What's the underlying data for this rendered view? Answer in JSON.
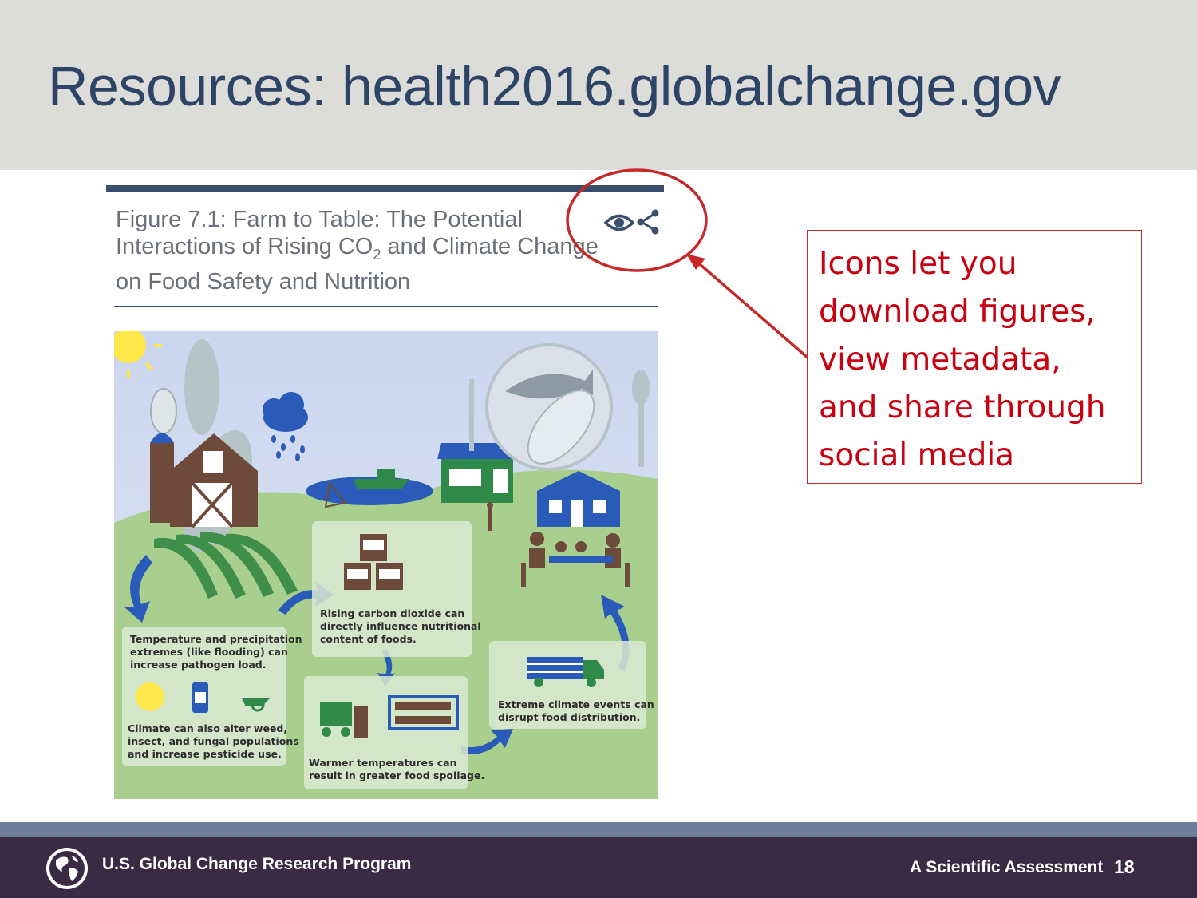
{
  "slide": {
    "title": "Resources: health2016.globalchange.gov",
    "page_number": "18"
  },
  "figure": {
    "caption_line1": "Figure 7.1: Farm to Table: The Potential",
    "caption_line2_pre": "Interactions of Rising CO",
    "caption_line2_sub": "2",
    "caption_line2_post": " and Climate Change",
    "caption_line3": "on Food Safety and Nutrition",
    "icons": [
      "eye-icon",
      "share-icon"
    ],
    "panels": {
      "temperature": [
        "Temperature and precipitation",
        "extremes (like flooding) can",
        "increase pathogen load."
      ],
      "climate_weed": [
        "Climate can also alter weed,",
        "insect, and fungal populations",
        "and increase pesticide use."
      ],
      "co2": [
        "Rising carbon dioxide can",
        "directly influence nutritional",
        "content of foods."
      ],
      "spoilage": [
        "Warmer temperatures can",
        "result in greater food spoilage."
      ],
      "extreme": [
        "Extreme climate events can",
        "disrupt food distribution."
      ]
    }
  },
  "callout": {
    "lines": [
      "Icons let you",
      "download figures,",
      "view metadata,",
      "and share through",
      "social media"
    ],
    "color": "#c8000f"
  },
  "footer": {
    "org": "U.S. Global Change Research Program",
    "tagline": "A Scientific Assessment"
  },
  "colors": {
    "title": "#2d4466",
    "title_band": "#dcdcd8",
    "footer": "#3a2a43",
    "footer_stripe": "#6e7d99",
    "accent_red": "#c62828"
  }
}
